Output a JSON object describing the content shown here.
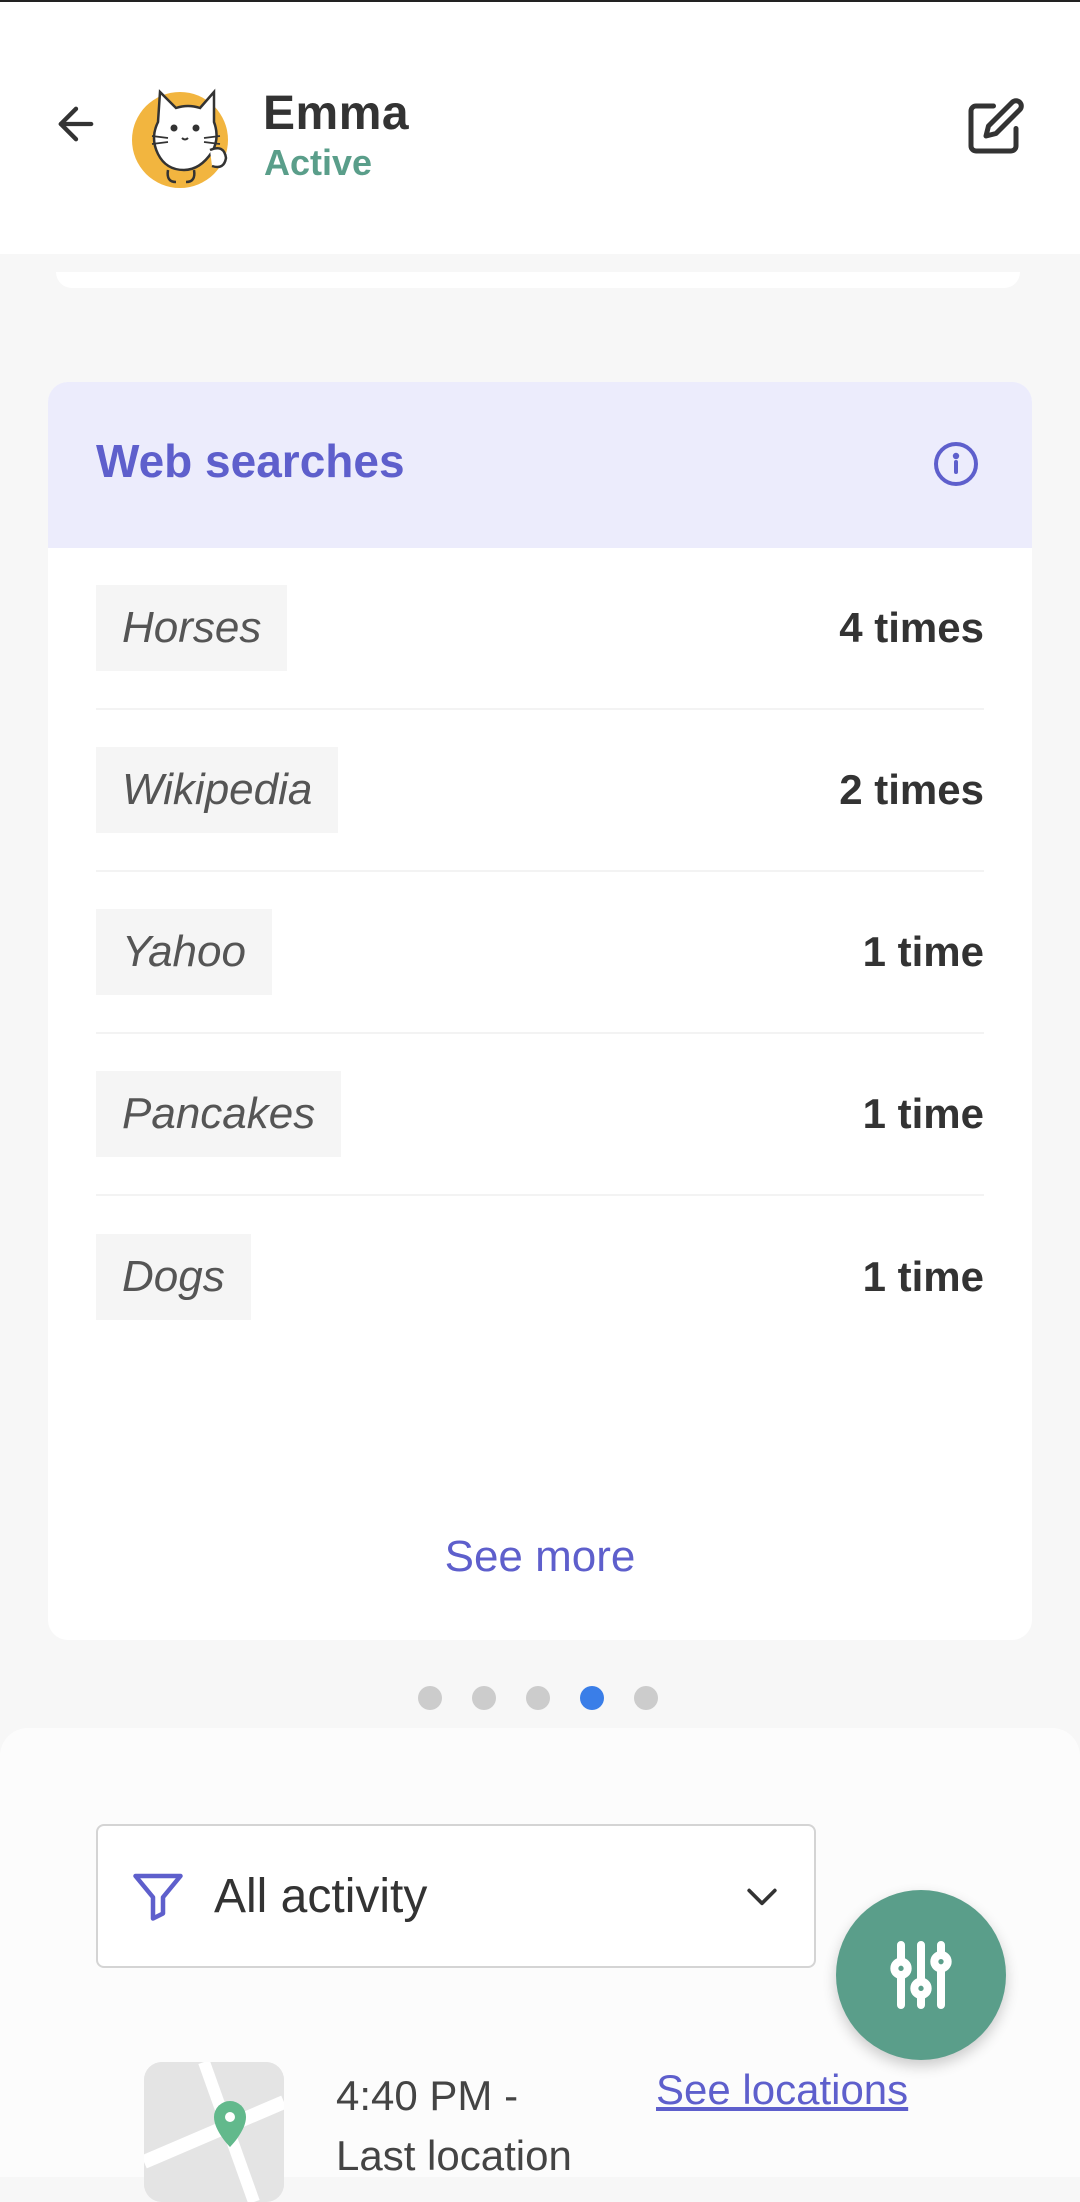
{
  "header": {
    "name": "Emma",
    "status": "Active"
  },
  "web_searches": {
    "title": "Web searches",
    "rows": [
      {
        "term": "Horses",
        "count": "4 times"
      },
      {
        "term": "Wikipedia",
        "count": "2 times"
      },
      {
        "term": "Yahoo",
        "count": "1 time"
      },
      {
        "term": "Pancakes",
        "count": "1 time"
      },
      {
        "term": "Dogs",
        "count": "1 time"
      }
    ],
    "see_more": "See more"
  },
  "pagination": {
    "pages": 5,
    "active_index": 3
  },
  "filter": {
    "label": "All activity"
  },
  "location": {
    "time_line1": "4:40 PM -",
    "time_line2": "Last location",
    "link": "See locations"
  },
  "colors": {
    "accent": "#5e5fcc",
    "status_green": "#5a9e8a",
    "dot_active": "#3a7ee8"
  }
}
